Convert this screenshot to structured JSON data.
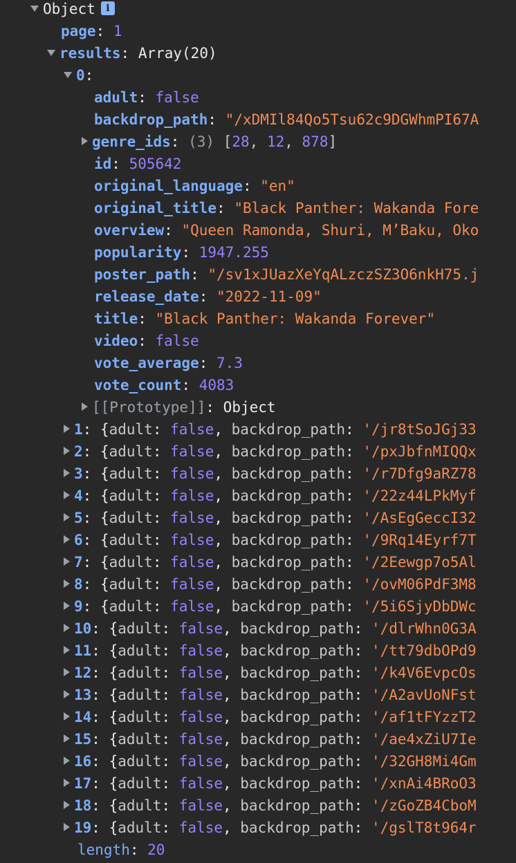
{
  "root": {
    "label": "Object",
    "info_icon_text": "i"
  },
  "page": {
    "key": "page",
    "value": "1"
  },
  "results": {
    "key": "results",
    "summary": "Array(20)"
  },
  "item0": {
    "index": "0",
    "adult": {
      "key": "adult",
      "value": "false"
    },
    "backdrop_path": {
      "key": "backdrop_path",
      "value": "\"/xDMIl84Qo5Tsu62c9DGWhmPI67A"
    },
    "genre_ids": {
      "key": "genre_ids",
      "count": "(3)",
      "open": "[",
      "v1": "28",
      "v2": "12",
      "v3": "878",
      "close": "]"
    },
    "id": {
      "key": "id",
      "value": "505642"
    },
    "original_language": {
      "key": "original_language",
      "value": "\"en\""
    },
    "original_title": {
      "key": "original_title",
      "value": "\"Black Panther: Wakanda Fore"
    },
    "overview": {
      "key": "overview",
      "value": "\"Queen Ramonda, Shuri, M’Baku, Oko"
    },
    "popularity": {
      "key": "popularity",
      "value": "1947.255"
    },
    "poster_path": {
      "key": "poster_path",
      "value": "\"/sv1xJUazXeYqALzczSZ3O6nkH75.j"
    },
    "release_date": {
      "key": "release_date",
      "value": "\"2022-11-09\""
    },
    "title": {
      "key": "title",
      "value": "\"Black Panther: Wakanda Forever\""
    },
    "video": {
      "key": "video",
      "value": "false"
    },
    "vote_average": {
      "key": "vote_average",
      "value": "7.3"
    },
    "vote_count": {
      "key": "vote_count",
      "value": "4083"
    },
    "prototype": {
      "key": "[[Prototype]]",
      "value": "Object"
    }
  },
  "collapsed_rows": [
    {
      "index": "1",
      "path": "'/jr8tSoJGj33"
    },
    {
      "index": "2",
      "path": "'/pxJbfnMIQQx"
    },
    {
      "index": "3",
      "path": "'/r7Dfg9aRZ78"
    },
    {
      "index": "4",
      "path": "'/22z44LPkMyf"
    },
    {
      "index": "5",
      "path": "'/AsEgGeccI32"
    },
    {
      "index": "6",
      "path": "'/9Rq14Eyrf7T"
    },
    {
      "index": "7",
      "path": "'/2Eewgp7o5Al"
    },
    {
      "index": "8",
      "path": "'/ovM06PdF3M8"
    },
    {
      "index": "9",
      "path": "'/5i6SjyDbDWc"
    },
    {
      "index": "10",
      "path": "'/dlrWhn0G3A"
    },
    {
      "index": "11",
      "path": "'/tt79dbOPd9"
    },
    {
      "index": "12",
      "path": "'/k4V6EvpcOs"
    },
    {
      "index": "13",
      "path": "'/A2avUoNFst"
    },
    {
      "index": "14",
      "path": "'/af1tFYzzT2"
    },
    {
      "index": "15",
      "path": "'/ae4xZiU7Ie"
    },
    {
      "index": "16",
      "path": "'/32GH8Mi4Gm"
    },
    {
      "index": "17",
      "path": "'/xnAi4BRoO3"
    },
    {
      "index": "18",
      "path": "'/zGoZB4CboM"
    },
    {
      "index": "19",
      "path": "'/gslT8t964r"
    }
  ],
  "collapsed_common": {
    "open_brace": "{",
    "adult_key": "adult",
    "adult_value": "false",
    "backdrop_key": "backdrop_path"
  },
  "length": {
    "key": "length",
    "value": "20"
  }
}
